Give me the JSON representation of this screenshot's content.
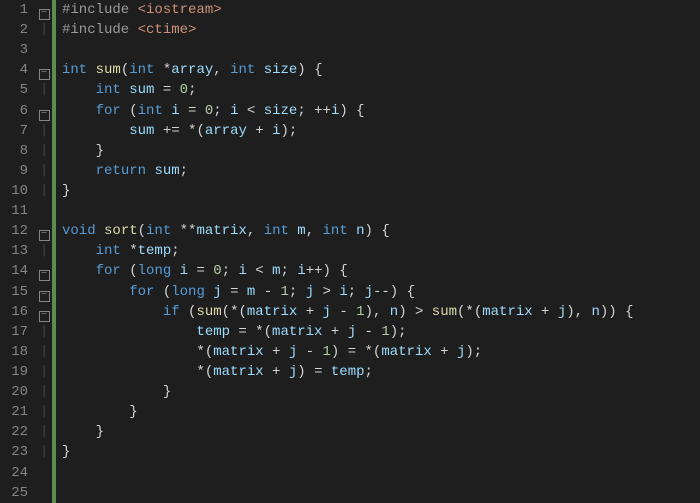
{
  "lines": [
    {
      "n": 1,
      "fold": "minus",
      "tokens": [
        [
          "preproc-kw",
          "#include "
        ],
        [
          "str",
          "<iostream>"
        ]
      ]
    },
    {
      "n": 2,
      "fold": "bar",
      "tokens": [
        [
          "preproc-kw",
          "#include "
        ],
        [
          "str",
          "<ctime>"
        ]
      ]
    },
    {
      "n": 3,
      "fold": "",
      "tokens": [
        [
          "punct",
          ""
        ]
      ]
    },
    {
      "n": 4,
      "fold": "minus",
      "tokens": [
        [
          "type",
          "int "
        ],
        [
          "fn",
          "sum"
        ],
        [
          "punct",
          "("
        ],
        [
          "type",
          "int "
        ],
        [
          "punct",
          "*"
        ],
        [
          "param",
          "array"
        ],
        [
          "punct",
          ", "
        ],
        [
          "type",
          "int "
        ],
        [
          "param",
          "size"
        ],
        [
          "punct",
          ") {"
        ]
      ]
    },
    {
      "n": 5,
      "fold": "bar",
      "tokens": [
        [
          "punct",
          "    "
        ],
        [
          "type",
          "int "
        ],
        [
          "param",
          "sum"
        ],
        [
          "punct",
          " = "
        ],
        [
          "num",
          "0"
        ],
        [
          "punct",
          ";"
        ]
      ]
    },
    {
      "n": 6,
      "fold": "minus",
      "tokens": [
        [
          "punct",
          "    "
        ],
        [
          "kw",
          "for"
        ],
        [
          "punct",
          " ("
        ],
        [
          "type",
          "int "
        ],
        [
          "param",
          "i"
        ],
        [
          "punct",
          " = "
        ],
        [
          "num",
          "0"
        ],
        [
          "punct",
          "; "
        ],
        [
          "param",
          "i"
        ],
        [
          "punct",
          " < "
        ],
        [
          "param",
          "size"
        ],
        [
          "punct",
          "; ++"
        ],
        [
          "param",
          "i"
        ],
        [
          "punct",
          ") {"
        ]
      ]
    },
    {
      "n": 7,
      "fold": "bar",
      "tokens": [
        [
          "punct",
          "        "
        ],
        [
          "param",
          "sum"
        ],
        [
          "punct",
          " += *("
        ],
        [
          "param",
          "array"
        ],
        [
          "punct",
          " + "
        ],
        [
          "param",
          "i"
        ],
        [
          "punct",
          ");"
        ]
      ]
    },
    {
      "n": 8,
      "fold": "bar",
      "tokens": [
        [
          "punct",
          "    }"
        ]
      ]
    },
    {
      "n": 9,
      "fold": "bar",
      "tokens": [
        [
          "punct",
          "    "
        ],
        [
          "kw",
          "return"
        ],
        [
          "punct",
          " "
        ],
        [
          "param",
          "sum"
        ],
        [
          "punct",
          ";"
        ]
      ]
    },
    {
      "n": 10,
      "fold": "bar",
      "tokens": [
        [
          "punct",
          "}"
        ]
      ]
    },
    {
      "n": 11,
      "fold": "",
      "tokens": [
        [
          "punct",
          ""
        ]
      ]
    },
    {
      "n": 12,
      "fold": "minus",
      "tokens": [
        [
          "type",
          "void "
        ],
        [
          "fn",
          "sort"
        ],
        [
          "punct",
          "("
        ],
        [
          "type",
          "int "
        ],
        [
          "punct",
          "**"
        ],
        [
          "param",
          "matrix"
        ],
        [
          "punct",
          ", "
        ],
        [
          "type",
          "int "
        ],
        [
          "param",
          "m"
        ],
        [
          "punct",
          ", "
        ],
        [
          "type",
          "int "
        ],
        [
          "param",
          "n"
        ],
        [
          "punct",
          ") {"
        ]
      ]
    },
    {
      "n": 13,
      "fold": "bar",
      "tokens": [
        [
          "punct",
          "    "
        ],
        [
          "type",
          "int "
        ],
        [
          "punct",
          "*"
        ],
        [
          "param",
          "temp"
        ],
        [
          "punct",
          ";"
        ]
      ]
    },
    {
      "n": 14,
      "fold": "minus",
      "tokens": [
        [
          "punct",
          "    "
        ],
        [
          "kw",
          "for"
        ],
        [
          "punct",
          " ("
        ],
        [
          "type",
          "long "
        ],
        [
          "param",
          "i"
        ],
        [
          "punct",
          " = "
        ],
        [
          "num",
          "0"
        ],
        [
          "punct",
          "; "
        ],
        [
          "param",
          "i"
        ],
        [
          "punct",
          " < "
        ],
        [
          "param",
          "m"
        ],
        [
          "punct",
          "; "
        ],
        [
          "param",
          "i"
        ],
        [
          "punct",
          "++) {"
        ]
      ]
    },
    {
      "n": 15,
      "fold": "minus",
      "tokens": [
        [
          "punct",
          "        "
        ],
        [
          "kw",
          "for"
        ],
        [
          "punct",
          " ("
        ],
        [
          "type",
          "long "
        ],
        [
          "param",
          "j"
        ],
        [
          "punct",
          " = "
        ],
        [
          "param",
          "m"
        ],
        [
          "punct",
          " - "
        ],
        [
          "num",
          "1"
        ],
        [
          "punct",
          "; "
        ],
        [
          "param",
          "j"
        ],
        [
          "punct",
          " > "
        ],
        [
          "param",
          "i"
        ],
        [
          "punct",
          "; "
        ],
        [
          "param",
          "j"
        ],
        [
          "punct",
          "--) {"
        ]
      ]
    },
    {
      "n": 16,
      "fold": "minus",
      "tokens": [
        [
          "punct",
          "            "
        ],
        [
          "kw",
          "if"
        ],
        [
          "punct",
          " ("
        ],
        [
          "fn",
          "sum"
        ],
        [
          "punct",
          "(*("
        ],
        [
          "param",
          "matrix"
        ],
        [
          "punct",
          " + "
        ],
        [
          "param",
          "j"
        ],
        [
          "punct",
          " - "
        ],
        [
          "num",
          "1"
        ],
        [
          "punct",
          "), "
        ],
        [
          "param",
          "n"
        ],
        [
          "punct",
          ") > "
        ],
        [
          "fn",
          "sum"
        ],
        [
          "punct",
          "(*("
        ],
        [
          "param",
          "matrix"
        ],
        [
          "punct",
          " + "
        ],
        [
          "param",
          "j"
        ],
        [
          "punct",
          "), "
        ],
        [
          "param",
          "n"
        ],
        [
          "punct",
          ")) {"
        ]
      ]
    },
    {
      "n": 17,
      "fold": "bar",
      "tokens": [
        [
          "punct",
          "                "
        ],
        [
          "param",
          "temp"
        ],
        [
          "punct",
          " = *("
        ],
        [
          "param",
          "matrix"
        ],
        [
          "punct",
          " + "
        ],
        [
          "param",
          "j"
        ],
        [
          "punct",
          " - "
        ],
        [
          "num",
          "1"
        ],
        [
          "punct",
          ");"
        ]
      ]
    },
    {
      "n": 18,
      "fold": "bar",
      "tokens": [
        [
          "punct",
          "                *("
        ],
        [
          "param",
          "matrix"
        ],
        [
          "punct",
          " + "
        ],
        [
          "param",
          "j"
        ],
        [
          "punct",
          " - "
        ],
        [
          "num",
          "1"
        ],
        [
          "punct",
          ") = *("
        ],
        [
          "param",
          "matrix"
        ],
        [
          "punct",
          " + "
        ],
        [
          "param",
          "j"
        ],
        [
          "punct",
          ");"
        ]
      ]
    },
    {
      "n": 19,
      "fold": "bar",
      "tokens": [
        [
          "punct",
          "                *("
        ],
        [
          "param",
          "matrix"
        ],
        [
          "punct",
          " + "
        ],
        [
          "param",
          "j"
        ],
        [
          "punct",
          ") = "
        ],
        [
          "param",
          "temp"
        ],
        [
          "punct",
          ";"
        ]
      ]
    },
    {
      "n": 20,
      "fold": "bar",
      "tokens": [
        [
          "punct",
          "            }"
        ]
      ]
    },
    {
      "n": 21,
      "fold": "bar",
      "tokens": [
        [
          "punct",
          "        }"
        ]
      ]
    },
    {
      "n": 22,
      "fold": "bar",
      "tokens": [
        [
          "punct",
          "    }"
        ]
      ]
    },
    {
      "n": 23,
      "fold": "bar",
      "tokens": [
        [
          "punct",
          "}"
        ]
      ]
    },
    {
      "n": 24,
      "fold": "",
      "tokens": [
        [
          "punct",
          ""
        ]
      ]
    },
    {
      "n": 25,
      "fold": "",
      "tokens": [
        [
          "punct",
          ""
        ]
      ]
    }
  ]
}
